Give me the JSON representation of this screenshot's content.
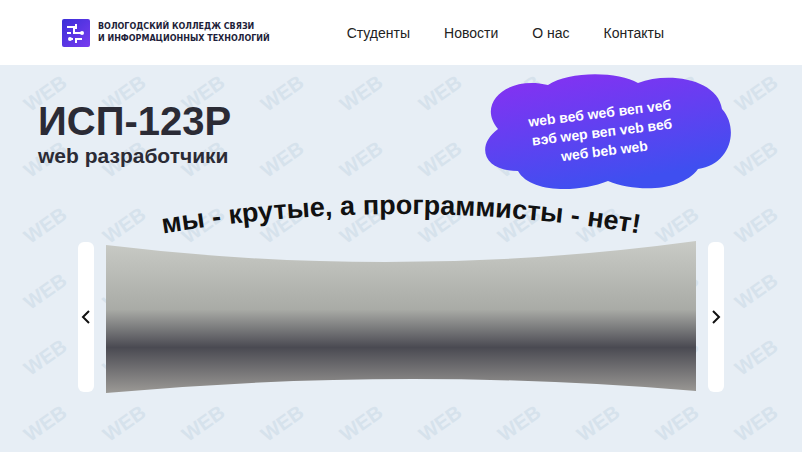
{
  "header": {
    "logo": {
      "line1": "ВОЛОГОДСКИЙ КОЛЛЕДЖ СВЯЗИ",
      "line2": "И ИНФОРМАЦИОННЫХ ТЕХНОЛОГИЙ"
    },
    "nav": [
      {
        "label": "Студенты"
      },
      {
        "label": "Новости"
      },
      {
        "label": "О нас"
      },
      {
        "label": "Контакты"
      }
    ]
  },
  "hero": {
    "title": "ИСП-123Р",
    "subtitle": "web разработчики",
    "cloud": [
      "web веб weб веп veб",
      "вэб wep веп veb веб",
      "weб beb web"
    ],
    "slogan": "мы - крутые, а программисты - нет!",
    "watermark": "WEB"
  }
}
